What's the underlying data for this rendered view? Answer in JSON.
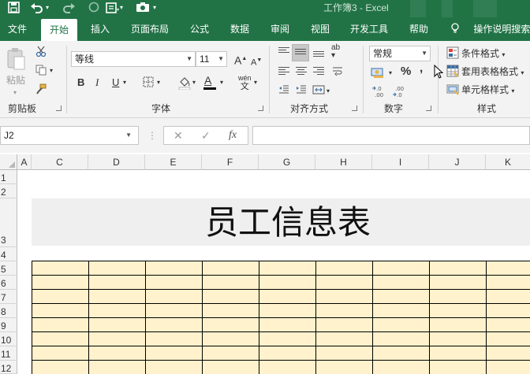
{
  "window": {
    "title": "工作簿3 - Excel"
  },
  "quick_access": {
    "icons": [
      "save-icon",
      "undo-icon",
      "undo-dropdown-icon",
      "redo-icon",
      "touch-mode-icon",
      "camera-icon",
      "qat-customize-icon"
    ]
  },
  "tabs": [
    {
      "label": "文件"
    },
    {
      "label": "开始"
    },
    {
      "label": "插入"
    },
    {
      "label": "页面布局"
    },
    {
      "label": "公式"
    },
    {
      "label": "数据"
    },
    {
      "label": "审阅"
    },
    {
      "label": "视图"
    },
    {
      "label": "开发工具"
    },
    {
      "label": "帮助"
    }
  ],
  "active_tab": "开始",
  "tell_me": {
    "label": "操作说明搜索",
    "icon": "lightbulb-icon"
  },
  "ribbon": {
    "clipboard": {
      "label": "剪贴板",
      "paste_label": "粘贴"
    },
    "font": {
      "label": "字体",
      "font_name": "等线",
      "font_size": "11",
      "grow": "A",
      "shrink": "A",
      "bold": "B",
      "italic": "I",
      "underline": "U",
      "font_color_glyph": "A",
      "phonetic": "wén",
      "phonetic_char": "文"
    },
    "alignment": {
      "label": "对齐方式",
      "orientation_glyph": "ab"
    },
    "number": {
      "label": "数字",
      "format": "常规",
      "percent": "%",
      "comma": ","
    },
    "styles": {
      "label": "样式",
      "conditional": "条件格式",
      "table_format": "套用表格格式",
      "cell_styles": "单元格样式"
    }
  },
  "formula_bar": {
    "name_box": "J2",
    "cancel": "✕",
    "enter": "✓",
    "fx": "fx",
    "formula": ""
  },
  "sheet": {
    "columns": [
      "A",
      "C",
      "D",
      "E",
      "F",
      "G",
      "H",
      "I",
      "J",
      "K"
    ],
    "rows": [
      "1",
      "2",
      "3",
      "4",
      "5",
      "6",
      "7",
      "8",
      "9",
      "10",
      "11",
      "12"
    ],
    "title_cell": "员工信息表",
    "fill_color": "#fff2cc",
    "title_fill_color": "#efefef"
  },
  "colors": {
    "accent": "#217346"
  }
}
